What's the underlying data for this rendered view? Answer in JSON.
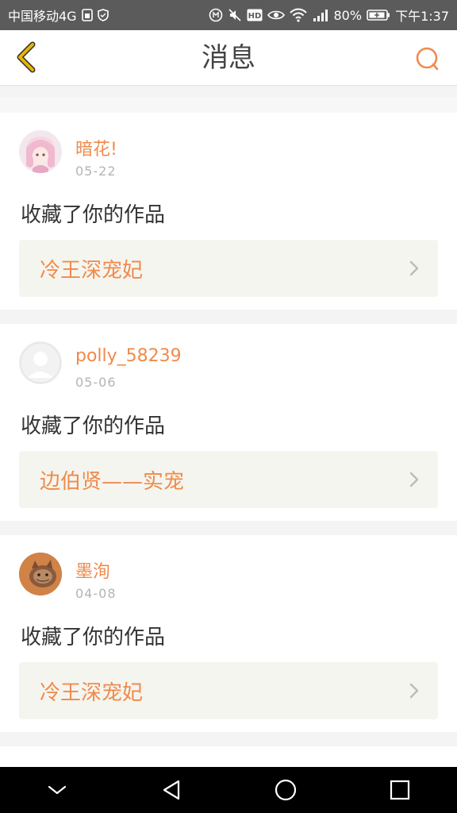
{
  "status_bar": {
    "carrier": "中国移动4G",
    "battery": "80%",
    "time": "下午1:37"
  },
  "header": {
    "title": "消息"
  },
  "messages": [
    {
      "user": "暗花!",
      "date": "05-22",
      "action": "收藏了你的作品",
      "work": "冷王深宠妃",
      "avatar": "anime-girl-avatar"
    },
    {
      "user": "polly_58239",
      "date": "05-06",
      "action": "收藏了你的作品",
      "work": "边伯贤——实宠",
      "avatar": "default-avatar"
    },
    {
      "user": "墨洵",
      "date": "04-08",
      "action": "收藏了你的作品",
      "work": "冷王深宠妃",
      "avatar": "cat-avatar"
    }
  ],
  "colors": {
    "accent": "#f08a4b",
    "back_arrow": "#e7b400",
    "status_bar_bg": "#5b5b5b",
    "nav_bar_bg": "#000000",
    "work_box_bg": "#f5f5ef"
  }
}
